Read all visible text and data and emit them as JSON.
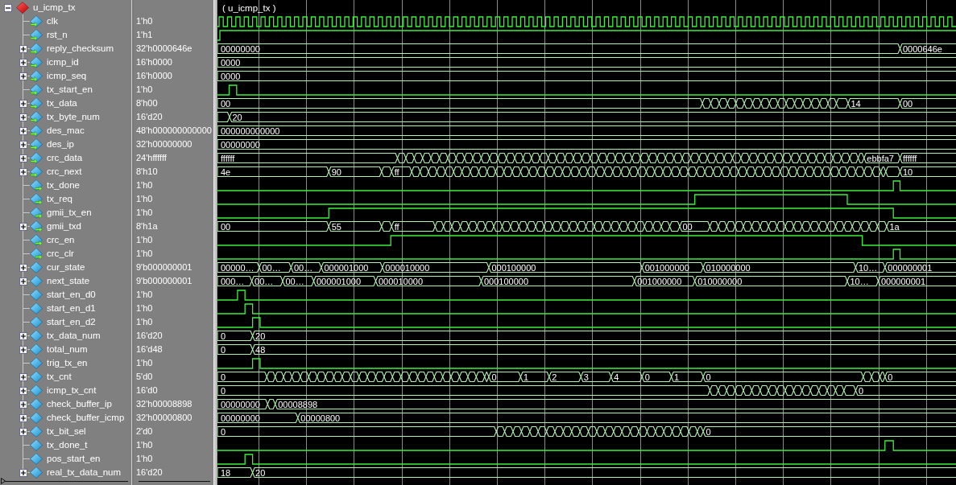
{
  "instance": {
    "name": "u_icmp_tx",
    "expanded": true,
    "wave_label": "( u_icmp_tx )",
    "signals": [
      {
        "name": "clk",
        "value": "1'h0",
        "kind": "clock"
      },
      {
        "name": "rst_n",
        "value": "1'h1",
        "kind": "bit"
      },
      {
        "name": "reply_checksum",
        "value": "32'h0000646e",
        "kind": "bus",
        "wave_labels": [
          "00000000",
          "0000646e"
        ]
      },
      {
        "name": "icmp_id",
        "value": "16'h0000",
        "kind": "bus",
        "wave_labels": [
          "0000"
        ]
      },
      {
        "name": "icmp_seq",
        "value": "16'h0000",
        "kind": "bus",
        "wave_labels": [
          "0000"
        ]
      },
      {
        "name": "tx_start_en",
        "value": "1'h0",
        "kind": "bit"
      },
      {
        "name": "tx_data",
        "value": "8'h00",
        "kind": "bus",
        "wave_labels": [
          "00",
          "14",
          "00"
        ]
      },
      {
        "name": "tx_byte_num",
        "value": "16'd20",
        "kind": "bus",
        "wave_labels": [
          "20"
        ]
      },
      {
        "name": "des_mac",
        "value": "48'h000000000000",
        "kind": "bus",
        "wave_labels": [
          "000000000000"
        ]
      },
      {
        "name": "des_ip",
        "value": "32'h00000000",
        "kind": "bus",
        "wave_labels": [
          "00000000"
        ]
      },
      {
        "name": "crc_data",
        "value": "24'hffffff",
        "kind": "bus",
        "wave_labels": [
          "ffffff",
          "ebbfa7",
          "ffffff"
        ]
      },
      {
        "name": "crc_next",
        "value": "8'h10",
        "kind": "bus",
        "wave_labels": [
          "4e",
          "90",
          "ff",
          "10"
        ]
      },
      {
        "name": "tx_done",
        "value": "1'h0",
        "kind": "bit"
      },
      {
        "name": "tx_req",
        "value": "1'h0",
        "kind": "bit"
      },
      {
        "name": "gmii_tx_en",
        "value": "1'h0",
        "kind": "bit"
      },
      {
        "name": "gmii_txd",
        "value": "8'h1a",
        "kind": "bus",
        "wave_labels": [
          "00",
          "55",
          "ff",
          "00",
          "1a"
        ]
      },
      {
        "name": "crc_en",
        "value": "1'h0",
        "kind": "bit"
      },
      {
        "name": "crc_clr",
        "value": "1'h0",
        "kind": "bit"
      },
      {
        "name": "cur_state",
        "value": "9'b000000001",
        "kind": "bus",
        "wave_labels": [
          "00000…",
          "00…",
          "00…",
          "000001000",
          "000010000",
          "000100000",
          "001000000",
          "010000000",
          "10…",
          "000000001"
        ]
      },
      {
        "name": "next_state",
        "value": "9'b000000001",
        "kind": "bus",
        "wave_labels": [
          "000…",
          "00…",
          "00…",
          "000001000",
          "000010000",
          "000100000",
          "001000000",
          "010000000",
          "10…",
          "000000001"
        ]
      },
      {
        "name": "start_en_d0",
        "value": "1'h0",
        "kind": "bit"
      },
      {
        "name": "start_en_d1",
        "value": "1'h0",
        "kind": "bit"
      },
      {
        "name": "start_en_d2",
        "value": "1'h0",
        "kind": "bit"
      },
      {
        "name": "tx_data_num",
        "value": "16'd20",
        "kind": "bus",
        "wave_labels": [
          "0",
          "20"
        ]
      },
      {
        "name": "total_num",
        "value": "16'd48",
        "kind": "bus",
        "wave_labels": [
          "0",
          "48"
        ]
      },
      {
        "name": "trig_tx_en",
        "value": "1'h0",
        "kind": "bit"
      },
      {
        "name": "tx_cnt",
        "value": "5'd0",
        "kind": "bus",
        "wave_labels": [
          "0",
          "0",
          "1",
          "2",
          "3",
          "4",
          "0",
          "1",
          "0",
          "0"
        ]
      },
      {
        "name": "icmp_tx_cnt",
        "value": "16'd0",
        "kind": "bus",
        "wave_labels": [
          "0",
          "0"
        ]
      },
      {
        "name": "check_buffer_ip",
        "value": "32'h00008898",
        "kind": "bus",
        "wave_labels": [
          "00000000",
          "00008898"
        ]
      },
      {
        "name": "check_buffer_icmp",
        "value": "32'h00000800",
        "kind": "bus",
        "wave_labels": [
          "00000000",
          "00000800"
        ]
      },
      {
        "name": "tx_bit_sel",
        "value": "2'd0",
        "kind": "bus",
        "wave_labels": [
          "0",
          "0"
        ]
      },
      {
        "name": "tx_done_t",
        "value": "1'h0",
        "kind": "bit"
      },
      {
        "name": "pos_start_en",
        "value": "1'h0",
        "kind": "bit"
      },
      {
        "name": "real_tx_data_num",
        "value": "16'd20",
        "kind": "bus",
        "wave_labels": [
          "18",
          "20"
        ]
      }
    ]
  }
}
